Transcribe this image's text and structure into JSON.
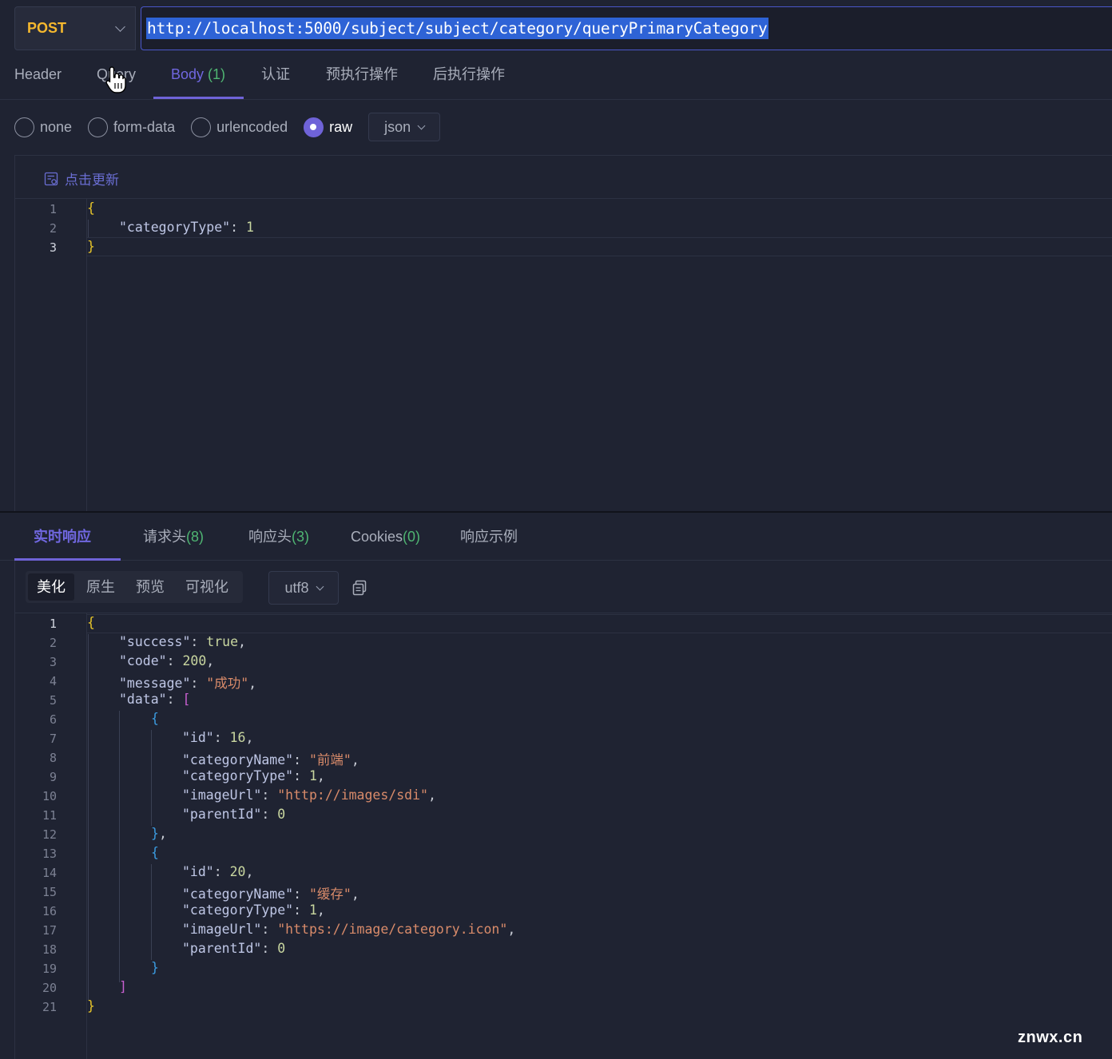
{
  "request": {
    "method": "POST",
    "url": "http://localhost:5000/subject/subject/category/queryPrimaryCategory"
  },
  "request_tabs": [
    {
      "label": "Header",
      "count": ""
    },
    {
      "label": "Query",
      "count": ""
    },
    {
      "label": "Body",
      "count": "(1)",
      "active": true
    },
    {
      "label": "认证",
      "count": ""
    },
    {
      "label": "预执行操作",
      "count": ""
    },
    {
      "label": "后执行操作",
      "count": ""
    }
  ],
  "body_types": [
    {
      "label": "none",
      "selected": false
    },
    {
      "label": "form-data",
      "selected": false
    },
    {
      "label": "urlencoded",
      "selected": false
    },
    {
      "label": "raw",
      "selected": true
    }
  ],
  "body_format": "json",
  "refresh_label": "点击更新",
  "request_body_lines": [
    "1",
    "2",
    "3"
  ],
  "request_body": {
    "key": "\"categoryType\"",
    "value": "1"
  },
  "response_tabs": [
    {
      "label": "实时响应",
      "count": "",
      "active": true
    },
    {
      "label": "请求头",
      "count": "(8)"
    },
    {
      "label": "响应头",
      "count": "(3)"
    },
    {
      "label": "Cookies",
      "count": "(0)"
    },
    {
      "label": "响应示例",
      "count": ""
    }
  ],
  "view_modes": [
    "美化",
    "原生",
    "预览",
    "可视化"
  ],
  "active_view_mode": "美化",
  "encoding": "utf8",
  "response_line_numbers": [
    "1",
    "2",
    "3",
    "4",
    "5",
    "6",
    "7",
    "8",
    "9",
    "10",
    "11",
    "12",
    "13",
    "14",
    "15",
    "16",
    "17",
    "18",
    "19",
    "20",
    "21"
  ],
  "response": {
    "success": "true",
    "code": "200",
    "message": "\"成功\"",
    "data": [
      {
        "id": "16",
        "categoryName": "\"前端\"",
        "categoryType": "1",
        "imageUrl": "\"http://images/sdi\"",
        "parentId": "0"
      },
      {
        "id": "20",
        "categoryName": "\"缓存\"",
        "categoryType": "1",
        "imageUrl": "\"https://image/category.icon\"",
        "parentId": "0"
      }
    ]
  },
  "keys": {
    "success": "\"success\"",
    "code": "\"code\"",
    "message": "\"message\"",
    "data": "\"data\"",
    "id": "\"id\"",
    "categoryName": "\"categoryName\"",
    "categoryType": "\"categoryType\"",
    "imageUrl": "\"imageUrl\"",
    "parentId": "\"parentId\""
  },
  "watermark": "znwx.cn",
  "colors": {
    "accent": "#6f63d8",
    "method": "#f5b82e",
    "count": "#4fb572",
    "string": "#d98b6a"
  }
}
